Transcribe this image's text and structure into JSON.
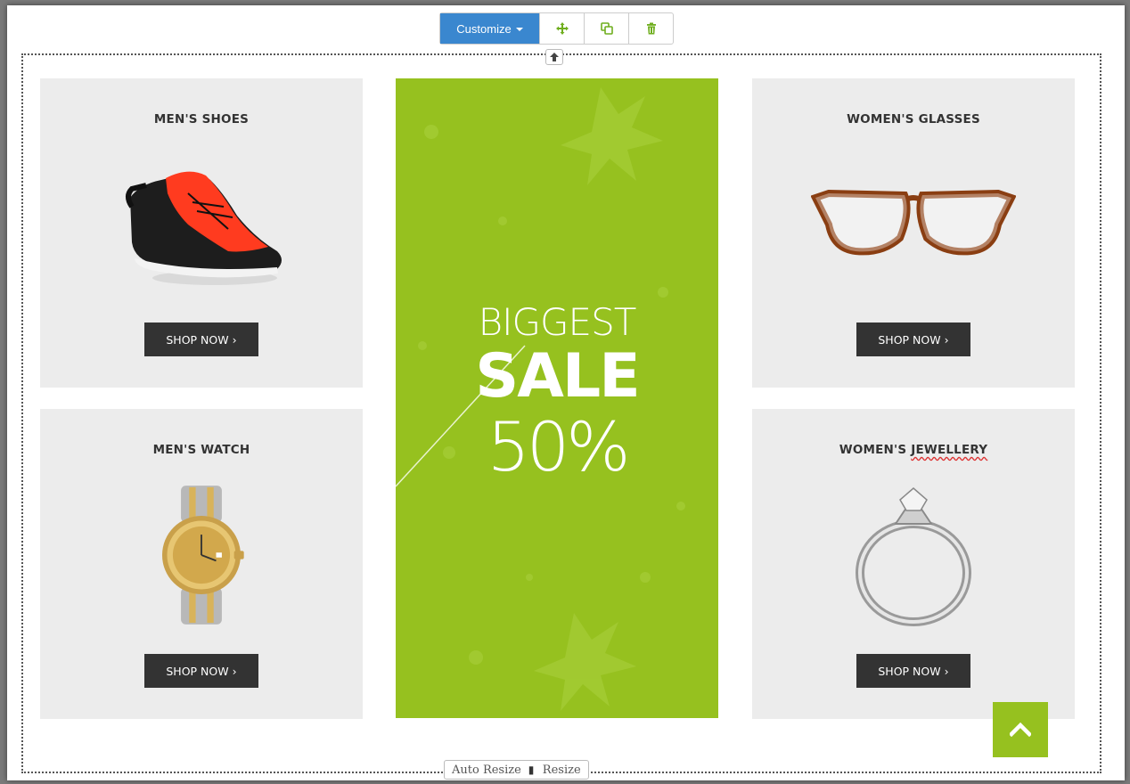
{
  "toolbar": {
    "customize_label": "Customize",
    "move_icon": "move-icon",
    "copy_icon": "copy-icon",
    "delete_icon": "trash-icon"
  },
  "cards": [
    {
      "title": "MEN'S SHOES",
      "button": "SHOP NOW"
    },
    {
      "title": "MEN'S WATCH",
      "button": "SHOP NOW"
    },
    {
      "title": "WOMEN'S GLASSES",
      "button": "SHOP NOW"
    },
    {
      "title_part1": "WOMEN'S ",
      "title_part2": "JEWELLERY",
      "button": "SHOP NOW"
    }
  ],
  "banner": {
    "line1": "BIGGEST",
    "line2": "SALE",
    "line3": "50%"
  },
  "resize": {
    "auto_resize": "Auto Resize",
    "resize": "Resize"
  },
  "colors": {
    "accent_green": "#96c11f",
    "toolbar_blue": "#3a87cf",
    "button_dark": "#333333",
    "card_bg": "#ececec"
  }
}
